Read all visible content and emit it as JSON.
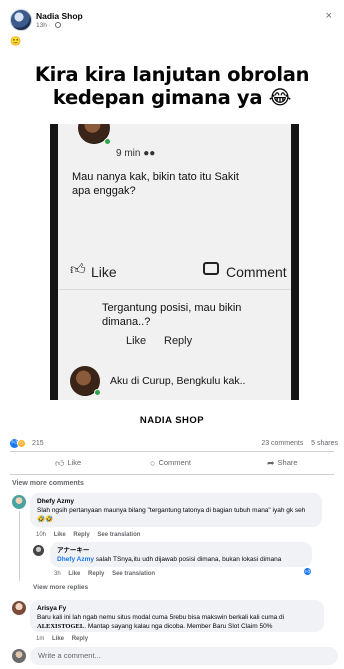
{
  "post": {
    "page_name": "Nadia Shop",
    "time": "13h",
    "time_sep": "·",
    "close_icon": "×",
    "emoji_line": "🙂",
    "meme": {
      "title_line1": "Kira kira lanjutan obrolan",
      "title_line2": "kedepan gimana ya 😂",
      "screenshot": {
        "time": "9 min",
        "comment1": "Mau nanya kak, bikin tato itu Sakit apa enggak?",
        "like": "Like",
        "comment": "Comment",
        "reply_text": "Tergantung posisi, mau bikin dimana..?",
        "reply_like": "Like",
        "reply_reply": "Reply",
        "comment3": "Aku di Curup, Bengkulu kak.."
      },
      "brand": "NADIA SHOP"
    },
    "reactions_count": "215",
    "comments_count": "23 comments",
    "shares_count": "5 shares",
    "actions": {
      "like": "Like",
      "comment": "Comment",
      "share": "Share"
    }
  },
  "comments": {
    "view_more": "View more comments",
    "items": [
      {
        "author": "Dhefy Azmy",
        "text": "Slah ngsih pertanyaan maunya bilang \"tergantung tatonya di bagian tubuh mana\" iyah gk seh 🤣🤣",
        "time": "10h",
        "like": "Like",
        "reply": "Reply",
        "see_translation": "See translation"
      },
      {
        "author": "アナーキー",
        "mention": "Dhefy Azmy",
        "text": " salah TSnya,itu udh dijawab posisi dimana, bukan lokasi dimana",
        "time": "3h",
        "like": "Like",
        "reply": "Reply",
        "see_translation": "See translation"
      },
      {
        "author": "Arisya Fy",
        "text_before": "Baru kali ini lah ngab nemu situs modal cuma 5rebu bisa makswin berkali kali cuma di ",
        "text_brand": "ALEXISTOGEL",
        "text_after": ". Mantap sayang kalau nga dicoba. Member Baru Slot Claim 50%",
        "time": "1m",
        "like": "Like",
        "reply": "Reply"
      }
    ],
    "view_more_replies": "View more replies",
    "write_placeholder": "Write a comment..."
  },
  "colors": {
    "accent": "#1877f2",
    "muted": "#65676b",
    "bubble": "#f0f2f5"
  }
}
